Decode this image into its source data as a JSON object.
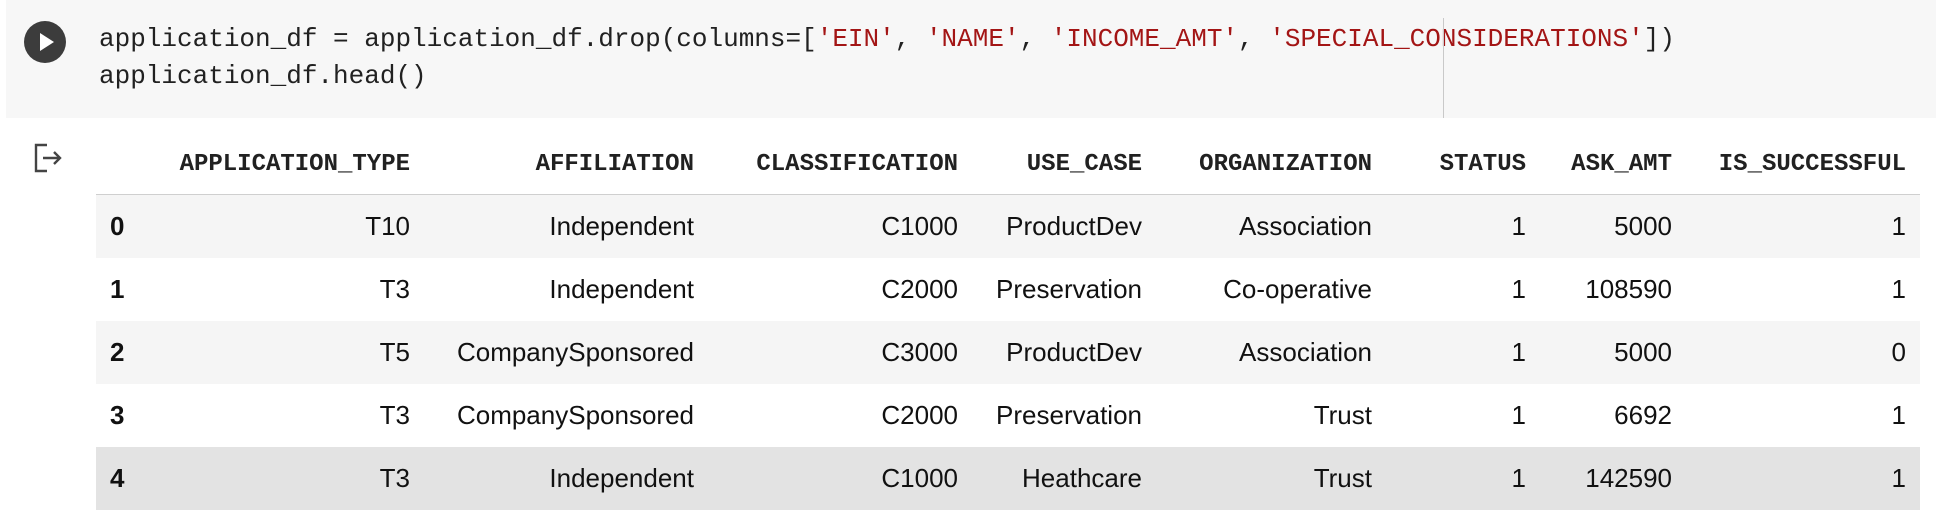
{
  "code_cell": {
    "lines": [
      [
        {
          "text": "application_df = application_df.drop(columns=[",
          "type": "plain"
        },
        {
          "text": "'EIN'",
          "type": "str"
        },
        {
          "text": ", ",
          "type": "plain"
        },
        {
          "text": "'NAME'",
          "type": "str"
        },
        {
          "text": ", ",
          "type": "plain"
        },
        {
          "text": "'INCOME_AMT'",
          "type": "str"
        },
        {
          "text": ", ",
          "type": "plain"
        },
        {
          "text": "'SPECIAL_CONSIDERATIONS'",
          "type": "str"
        },
        {
          "text": "])",
          "type": "plain"
        }
      ],
      [
        {
          "text": "application_df.head()",
          "type": "plain"
        }
      ]
    ],
    "run_icon": "play-icon"
  },
  "output": {
    "icon": "output-redirect-icon",
    "table": {
      "columns": [
        "",
        "APPLICATION_TYPE",
        "AFFILIATION",
        "CLASSIFICATION",
        "USE_CASE",
        "ORGANIZATION",
        "STATUS",
        "ASK_AMT",
        "IS_SUCCESSFUL"
      ],
      "rows": [
        [
          "0",
          "T10",
          "Independent",
          "C1000",
          "ProductDev",
          "Association",
          "1",
          "5000",
          "1"
        ],
        [
          "1",
          "T3",
          "Independent",
          "C2000",
          "Preservation",
          "Co-operative",
          "1",
          "108590",
          "1"
        ],
        [
          "2",
          "T5",
          "CompanySponsored",
          "C3000",
          "ProductDev",
          "Association",
          "1",
          "5000",
          "0"
        ],
        [
          "3",
          "T3",
          "CompanySponsored",
          "C2000",
          "Preservation",
          "Trust",
          "1",
          "6692",
          "1"
        ],
        [
          "4",
          "T3",
          "Independent",
          "C1000",
          "Heathcare",
          "Trust",
          "1",
          "142590",
          "1"
        ]
      ],
      "hovered_row": 4
    }
  },
  "colors": {
    "cell_background": "#f7f7f7",
    "string_literal": "#a31515",
    "run_button": "#3c3c3c"
  }
}
